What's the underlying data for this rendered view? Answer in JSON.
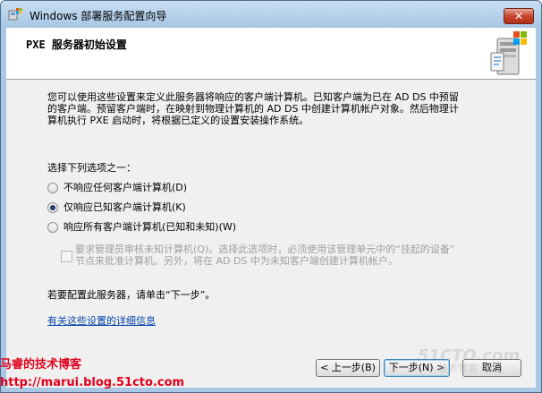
{
  "window": {
    "title": "Windows 部署服务配置向导",
    "close_label": "✕"
  },
  "header": {
    "title": "PXE 服务器初始设置"
  },
  "description": {
    "line1": "您可以使用这些设置来定义此服务器将响应的客户端计算机。已知客户端为已在 AD DS 中预留",
    "line2": "的客户端。预留客户端时，在映射到物理计算机的 AD DS 中创建计算机帐户对象。然后物理计",
    "line3": "算机执行 PXE 启动时，将根据已定义的设置安装操作系统。"
  },
  "options": {
    "prompt": "选择下列选项之一：",
    "items": [
      {
        "label": "不响应任何客户端计算机(D)",
        "checked": false
      },
      {
        "label": "仅响应已知客户端计算机(K)",
        "checked": true
      },
      {
        "label": "响应所有客户端计算机(已知和未知)(W)",
        "checked": false
      }
    ],
    "require_approval": {
      "line1": "要求管理员审核未知计算机(Q)。选择此选项时，必须使用该管理单元中的“挂起的设备”",
      "line2": "节点来批准计算机。另外，将在 AD DS 中为未知客户端创建计算机帐户。",
      "checked": false,
      "enabled": false
    }
  },
  "footer_text": "若要配置此服务器，请单击“下一步”。",
  "help_link": "有关这些设置的详细信息",
  "buttons": {
    "back": "< 上一步(B)",
    "next": "下一步(N) >",
    "cancel": "取消"
  },
  "overlay": {
    "watermark_site": "51CTO.com",
    "watermark_blog": "技术博客 Blog",
    "caption_name": "马睿的技术博客",
    "caption_url": "http://marui.blog.51cto.com"
  },
  "colors": {
    "link": "#0645ad",
    "caption": "#e0001b",
    "close_button": "#c8442c"
  }
}
